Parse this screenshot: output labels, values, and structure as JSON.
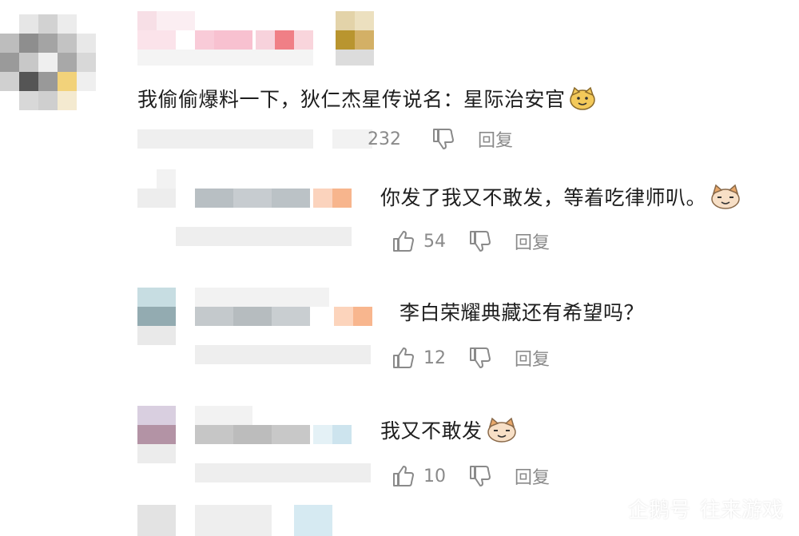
{
  "comments": [
    {
      "text": "我偷偷爆料一下，狄仁杰星传说名：星际治安官",
      "likes": "232",
      "reply_label": "回复"
    },
    {
      "text": "你发了我又不敢发，等着吃律师叭。",
      "likes": "54",
      "reply_label": "回复"
    },
    {
      "text": "李白荣耀典藏还有希望吗？",
      "likes": "12",
      "reply_label": "回复"
    },
    {
      "text": "我又不敢发",
      "likes": "10",
      "reply_label": "回复"
    }
  ],
  "watermark": {
    "brand": "企鹅号",
    "account": "往来游戏"
  },
  "icons": {
    "like": "thumbs-up-icon",
    "dislike": "thumbs-down-icon",
    "emoji": "smiling-cat-emoji-icon",
    "penguin": "penguin-logo-icon"
  }
}
